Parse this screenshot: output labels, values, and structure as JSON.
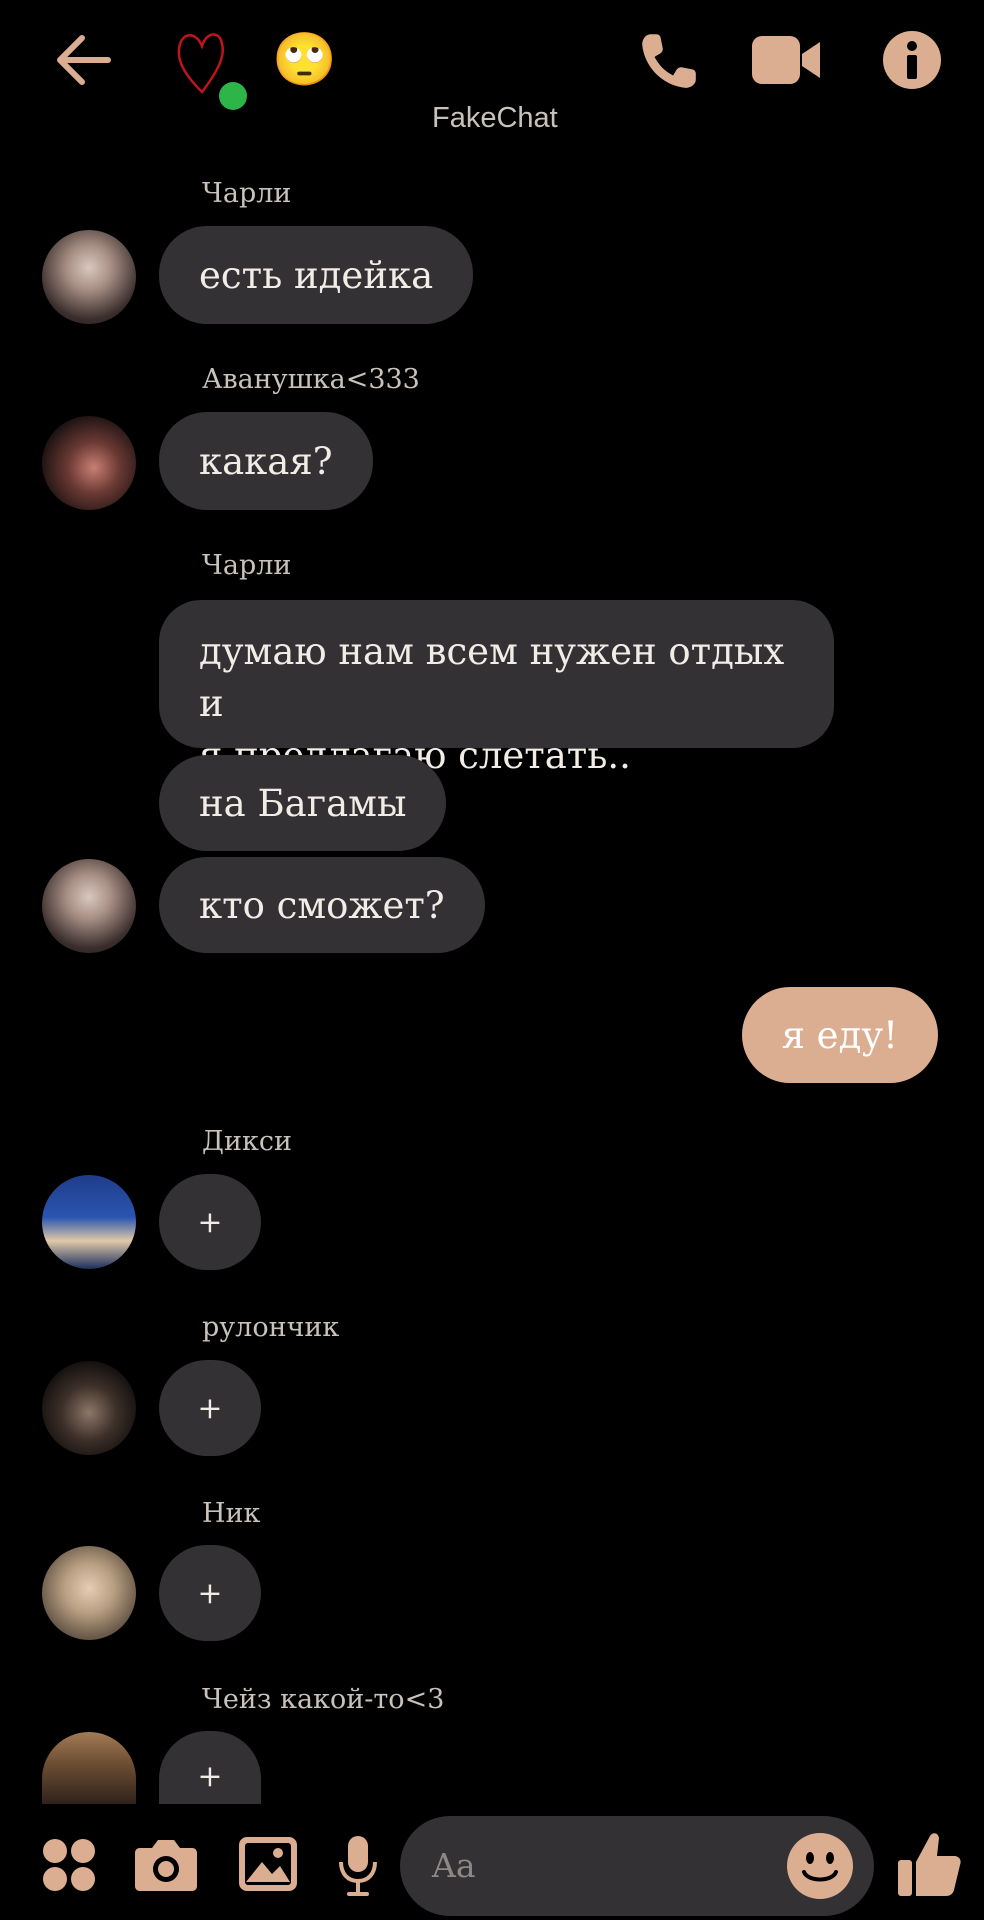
{
  "header": {
    "back_icon": "arrow-left-icon",
    "status_emoji": "🙄",
    "title": "FakeChat",
    "call_icon": "phone-icon",
    "video_icon": "video-camera-icon",
    "info_icon": "info-icon",
    "accent_color": "#dcae91",
    "online_color": "#2eb54a"
  },
  "messages": [
    {
      "sender": "Чарли",
      "text": "есть идейка"
    },
    {
      "sender": "Аванушка<333",
      "text": "какая?"
    },
    {
      "sender": "Чарли",
      "lines": [
        "думаю нам всем нужен отдых и",
        "я предлагаю слетать.."
      ],
      "followups": [
        "на Багамы",
        "кто сможет?"
      ]
    },
    {
      "self_text": "я еду!"
    },
    {
      "sender": "Дикси",
      "reaction": "+"
    },
    {
      "sender": "рулончик",
      "reaction": "+"
    },
    {
      "sender": "Ник",
      "reaction": "+"
    },
    {
      "sender": "Чейз какой-то<3",
      "reaction": "+"
    }
  ],
  "composer": {
    "placeholder": "Aa",
    "icons": [
      "apps-icon",
      "camera-icon",
      "image-icon",
      "microphone-icon",
      "emoji-icon",
      "thumbs-up-icon"
    ]
  }
}
